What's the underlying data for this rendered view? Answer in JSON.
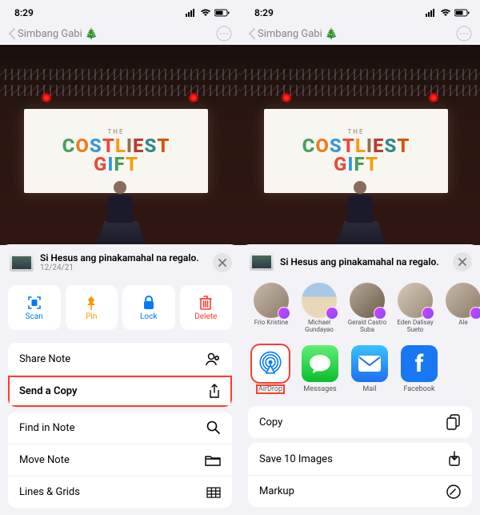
{
  "status": {
    "time": "8:29"
  },
  "nav": {
    "back_label": "Simbang Gabi 🎄"
  },
  "photo": {
    "small_text": "THE",
    "big_text": "COSTLIEST GIFT"
  },
  "sheet_left": {
    "title": "Si Hesus ang pinakamahal na regalo.",
    "date": "12/24/21",
    "actions": {
      "scan": "Scan",
      "pin": "Pin",
      "lock": "Lock",
      "delete": "Delete"
    },
    "menu1": [
      {
        "label": "Share Note"
      },
      {
        "label": "Send a Copy"
      }
    ],
    "menu2": [
      {
        "label": "Find in Note"
      },
      {
        "label": "Move Note"
      },
      {
        "label": "Lines & Grids"
      }
    ]
  },
  "sheet_right": {
    "title": "Si Hesus ang pinakamahal na regalo.",
    "contacts": [
      {
        "name": "Frio Kristine"
      },
      {
        "name": "Michael Gundayao"
      },
      {
        "name": "Gerald Castro Suba"
      },
      {
        "name": "Eden Dalisay Sueto"
      },
      {
        "name": "Ale"
      }
    ],
    "apps": [
      {
        "name": "AirDrop"
      },
      {
        "name": "Messages"
      },
      {
        "name": "Mail"
      },
      {
        "name": "Facebook"
      }
    ],
    "menu": [
      {
        "label": "Copy"
      },
      {
        "label": "Save 10 Images"
      },
      {
        "label": "Markup"
      }
    ]
  }
}
